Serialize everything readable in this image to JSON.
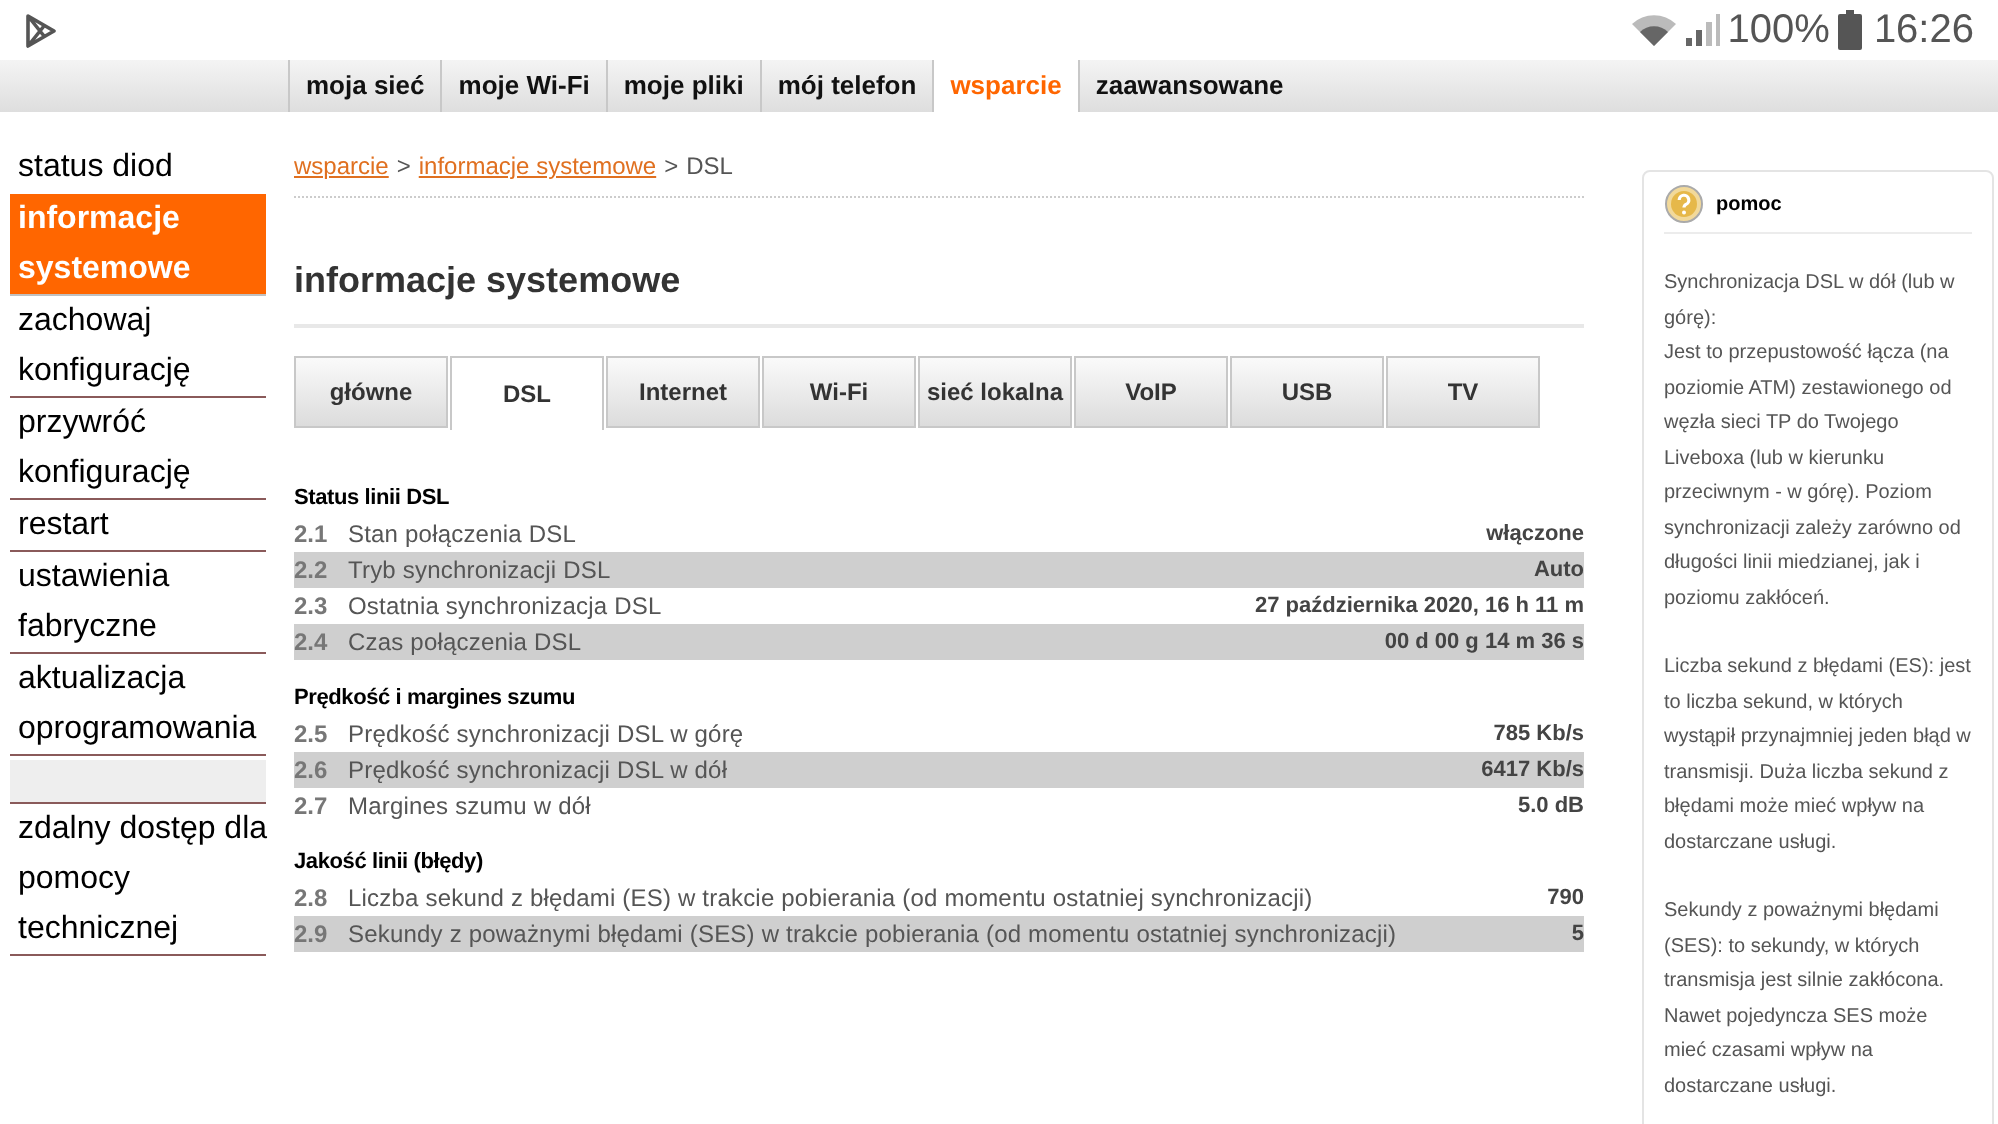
{
  "status_bar": {
    "battery": "100%",
    "time": "16:26"
  },
  "top_nav": [
    {
      "label": "moja sieć",
      "selected": false
    },
    {
      "label": "moje Wi-Fi",
      "selected": false
    },
    {
      "label": "moje pliki",
      "selected": false
    },
    {
      "label": "mój telefon",
      "selected": false
    },
    {
      "label": "wsparcie",
      "selected": true
    },
    {
      "label": "zaawansowane",
      "selected": false
    }
  ],
  "sidebar": {
    "items": [
      {
        "kind": "link",
        "lines": [
          "status diod"
        ],
        "selected": false
      },
      {
        "kind": "link",
        "lines": [
          "informacje",
          "systemowe"
        ],
        "selected": true
      },
      {
        "kind": "link",
        "lines": [
          "zachowaj",
          "konfigurację"
        ],
        "selected": false
      },
      {
        "kind": "link",
        "lines": [
          "przywróć",
          "konfigurację"
        ],
        "selected": false
      },
      {
        "kind": "link",
        "lines": [
          "restart"
        ],
        "selected": false
      },
      {
        "kind": "link",
        "lines": [
          "ustawienia",
          "fabryczne"
        ],
        "selected": false
      },
      {
        "kind": "link",
        "lines": [
          "aktualizacja",
          "oprogramowania"
        ],
        "selected": false
      },
      {
        "kind": "spacer"
      },
      {
        "kind": "link",
        "lines": [
          "zdalny dostęp dla",
          "pomocy",
          "technicznej"
        ],
        "selected": false
      }
    ]
  },
  "breadcrumb": [
    {
      "label": "wsparcie",
      "kind": "link"
    },
    {
      "label": ">",
      "kind": "sep"
    },
    {
      "label": "informacje systemowe",
      "kind": "link"
    },
    {
      "label": ">",
      "kind": "sep"
    },
    {
      "label": "DSL",
      "kind": "text"
    }
  ],
  "page_title": "informacje systemowe",
  "tabs": [
    {
      "label": "główne",
      "selected": false
    },
    {
      "label": "DSL",
      "selected": true
    },
    {
      "label": "Internet",
      "selected": false
    },
    {
      "label": "Wi-Fi",
      "selected": false
    },
    {
      "label": "sieć lokalna",
      "selected": false
    },
    {
      "label": "VoIP",
      "selected": false
    },
    {
      "label": "USB",
      "selected": false
    },
    {
      "label": "TV",
      "selected": false
    }
  ],
  "sections": [
    {
      "title": "Status linii DSL",
      "rows": [
        {
          "number": "2.1",
          "label": "Stan połączenia DSL",
          "value": "włączone"
        },
        {
          "number": "2.2",
          "label": "Tryb synchronizacji DSL",
          "value": "Auto"
        },
        {
          "number": "2.3",
          "label": "Ostatnia synchronizacja DSL",
          "value": "27 października 2020, 16 h 11 m"
        },
        {
          "number": "2.4",
          "label": "Czas połączenia DSL",
          "value": "00 d 00 g 14 m 36 s"
        }
      ]
    },
    {
      "title": "Prędkość i margines szumu",
      "rows": [
        {
          "number": "2.5",
          "label": "Prędkość synchronizacji DSL w górę",
          "value": "785 Kb/s"
        },
        {
          "number": "2.6",
          "label": "Prędkość synchronizacji DSL w dół",
          "value": "6417 Kb/s"
        },
        {
          "number": "2.7",
          "label": "Margines szumu w dół",
          "value": "5.0 dB"
        }
      ]
    },
    {
      "title": "Jakość linii (błędy)",
      "rows": [
        {
          "number": "2.8",
          "label": "Liczba sekund z błędami (ES) w trakcie pobierania (od momentu ostatniej synchronizacji)",
          "value": "790"
        },
        {
          "number": "2.9",
          "label": "Sekundy z poważnymi błędami (SES) w trakcie pobierania (od momentu ostatniej synchronizacji)",
          "value": "5"
        }
      ]
    }
  ],
  "help": {
    "title": "pomoc",
    "paragraphs": [
      [
        "Synchronizacja DSL w dół (lub w górę):",
        "Jest to przepustowość łącza (na poziomie ATM) zestawionego od węzła sieci TP do Twojego Liveboxa (lub w kierunku przeciwnym - w górę). Poziom synchronizacji zależy zarówno od długości linii miedzianej, jak i poziomu zakłóceń."
      ],
      [
        "Liczba sekund z błędami (ES): jest to liczba sekund, w których wystąpił przynajmniej jeden błąd w transmisji. Duża liczba sekund z błędami może mieć wpływ na dostarczane usługi."
      ],
      [
        "Sekundy z poważnymi błędami (SES): to sekundy, w których transmisja jest silnie zakłócona. Nawet pojedyncza SES może mieć czasami wpływ na dostarczane usługi."
      ]
    ]
  }
}
